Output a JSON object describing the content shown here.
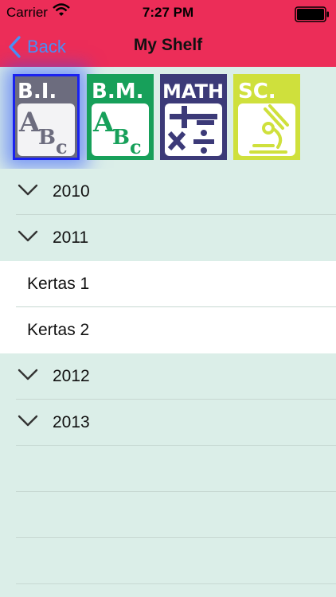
{
  "status": {
    "carrier": "Carrier",
    "time": "7:27 PM"
  },
  "nav": {
    "back_label": "Back",
    "title": "My Shelf"
  },
  "books": [
    {
      "code": "B.I.",
      "subject_icon": "abc-icon",
      "color": "#6c6c7e",
      "selected": true
    },
    {
      "code": "B.M.",
      "subject_icon": "abc-icon",
      "color": "#17a05a",
      "selected": false
    },
    {
      "code": "MATH",
      "subject_icon": "math-symbols-icon",
      "color": "#3c3a78",
      "selected": false
    },
    {
      "code": "SC.",
      "subject_icon": "microscope-icon",
      "color": "#cfe03c",
      "selected": false
    }
  ],
  "years": [
    {
      "label": "2010",
      "expanded": false,
      "items": []
    },
    {
      "label": "2011",
      "expanded": true,
      "items": [
        "Kertas 1",
        "Kertas 2"
      ]
    },
    {
      "label": "2012",
      "expanded": false,
      "items": []
    },
    {
      "label": "2013",
      "expanded": false,
      "items": []
    }
  ],
  "colors": {
    "nav_bar": "#ec2d58",
    "list_background": "#dbeee8",
    "back_tint": "#4a90f5"
  }
}
